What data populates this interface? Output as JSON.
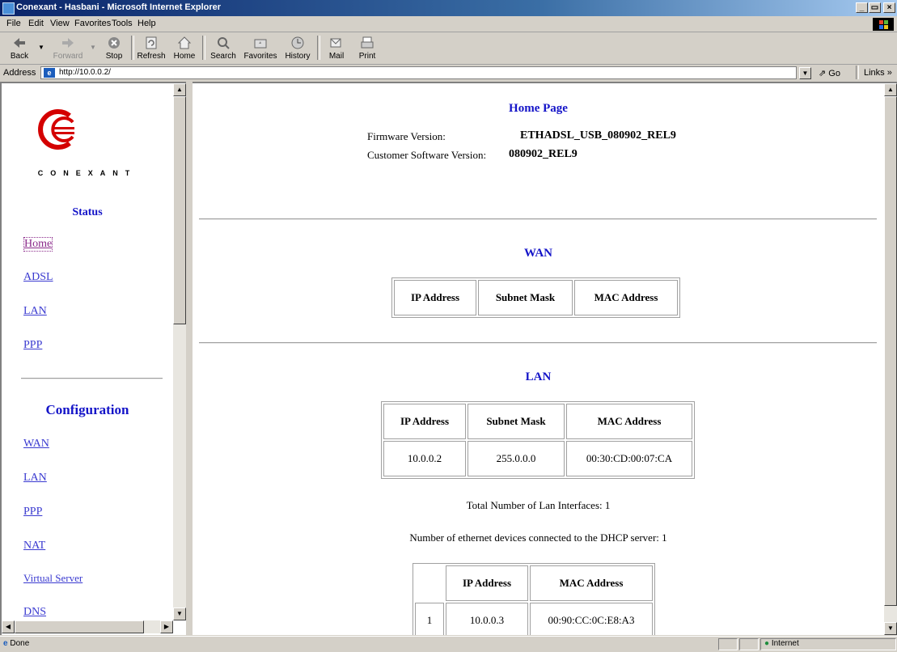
{
  "window": {
    "title": "Conexant - Hasbani - Microsoft Internet Explorer",
    "min": "_",
    "max": "□",
    "close": "×"
  },
  "menu": [
    "File",
    "Edit",
    "View",
    "Favorites",
    "Tools",
    "Help"
  ],
  "toolbar": {
    "back": "Back",
    "forward": "Forward",
    "stop": "Stop",
    "refresh": "Refresh",
    "home": "Home",
    "search": "Search",
    "favorites": "Favorites",
    "history": "History",
    "mail": "Mail",
    "print": "Print"
  },
  "address": {
    "label": "Address",
    "url": "http://10.0.0.2/",
    "go": "Go",
    "links": "Links"
  },
  "sidebar": {
    "brand": "CONEXANT",
    "status_heading": "Status",
    "status_links": [
      "Home",
      "ADSL",
      "LAN",
      "PPP"
    ],
    "config_heading": "Configuration",
    "config_links": [
      "WAN",
      "LAN",
      "PPP",
      "NAT",
      "Virtual Server",
      "DNS"
    ]
  },
  "main": {
    "page_title": "Home Page",
    "firmware_label": "Firmware Version:",
    "firmware_value": "ETHADSL_USB_080902_REL9",
    "customer_label": "Customer Software Version:",
    "customer_value": "080902_REL9",
    "wan": {
      "title": "WAN",
      "headers": [
        "IP Address",
        "Subnet Mask",
        "MAC Address"
      ]
    },
    "lan": {
      "title": "LAN",
      "headers": [
        "IP Address",
        "Subnet Mask",
        "MAC Address"
      ],
      "row": [
        "10.0.0.2",
        "255.0.0.0",
        "00:30:CD:00:07:CA"
      ],
      "total_interfaces": "Total Number of Lan Interfaces: 1",
      "dhcp_devices": "Number of ethernet devices connected to the DHCP server: 1"
    },
    "dhcp": {
      "headers": [
        "",
        "IP Address",
        "MAC Address"
      ],
      "row": [
        "1",
        "10.0.0.3",
        "00:90:CC:0C:E8:A3"
      ]
    }
  },
  "statusbar": {
    "left": "Done",
    "zone": "Internet"
  },
  "colors": {
    "link": "#3a3ad0",
    "heading": "#1414c8",
    "titlebar": "#0a246a"
  }
}
